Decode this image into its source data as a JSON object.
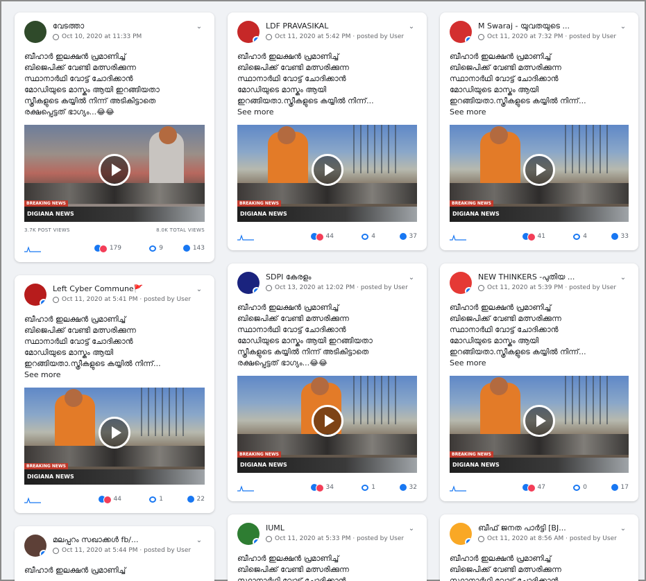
{
  "post_text_full": "ബീഹാർ ഇലക്ഷൻ പ്രമാണിച്ച്\nബിജെപിക്ക് വേണ്ടി മത്സരിക്കുന്ന\nസ്ഥാനാർഥി വോട്ട് ചോദിക്കാൻ\nമോഡിയുടെ മാസ്കും ആയി ഇറങ്ങിയതാ\nസ്ത്രീകളുടെ കയ്യിൽ നിന്ന് അടികിട്ടാതെ\nരക്ഷപ്പെട്ടത് ഭാഗ്യം...😂😂",
  "post_text_trunc_a": "ബീഹാർ ഇലക്ഷൻ പ്രമാണിച്ച്\nബിജെപിക്ക് വേണ്ടി മത്സരിക്കുന്ന\nസ്ഥാനാർഥി വോട്ട് ചോദിക്കാൻ\nമോഡിയുടെ മാസ്കും ആയി\nഇറങ്ങിയതാ.സ്ത്രീകളുടെ കയ്യിൽ നിന്ന്...",
  "post_text_short": "ബീഹാർ ഇലക്ഷൻ പ്രമാണിച്ച്",
  "see_more": "See more",
  "channel": "DIGIANA NEWS",
  "breaking": "BREAKING NEWS",
  "posts": [
    {
      "page": "വേടത്താ",
      "meta": "Oct 10, 2020 at 11:33 PM",
      "reactions": "179",
      "comments": "9",
      "shares": "143",
      "post_views": "3.7K POST VIEWS",
      "total_views": "8.0K TOTAL VIEWS",
      "avatar_color": "#2f4a2a"
    },
    {
      "page": "LDF PRAVASIKAL",
      "meta": "Oct 11, 2020 at 5:42 PM · posted by User",
      "reactions": "44",
      "comments": "4",
      "shares": "37",
      "avatar_color": "#c62828"
    },
    {
      "page": "M Swaraj - യുവതയുടെ ...",
      "meta": "Oct 11, 2020 at 7:32 PM · posted by User",
      "reactions": "41",
      "comments": "4",
      "shares": "33",
      "avatar_color": "#d32f2f"
    },
    {
      "page": "Left Cyber Commune🚩",
      "meta": "Oct 11, 2020 at 5:41 PM · posted by User",
      "reactions": "44",
      "comments": "1",
      "shares": "22",
      "avatar_color": "#b71c1c"
    },
    {
      "page": "SDPI കേരളം",
      "meta": "Oct 13, 2020 at 12:02 PM · posted by User",
      "reactions": "34",
      "comments": "1",
      "shares": "32",
      "avatar_color": "#1a237e"
    },
    {
      "page": "NEW THINKERS -പുതിയ ...",
      "meta": "Oct 11, 2020 at 5:39 PM · posted by User",
      "reactions": "47",
      "comments": "0",
      "shares": "17",
      "avatar_color": "#e53935"
    },
    {
      "page": "മലപ്പുറം സഖാക്കൾ fb/...",
      "meta": "Oct 11, 2020 at 5:44 PM · posted by User",
      "avatar_color": "#5d4037"
    },
    {
      "page": "IUML",
      "meta": "Oct 11, 2020 at 5:33 PM · posted by User",
      "avatar_color": "#2e7d32"
    },
    {
      "page": "ബീഫ് ജനത പാർട്ടി [BJ...",
      "meta": "Oct 11, 2020 at 8:56 AM · posted by User",
      "avatar_color": "#f9a825"
    }
  ]
}
